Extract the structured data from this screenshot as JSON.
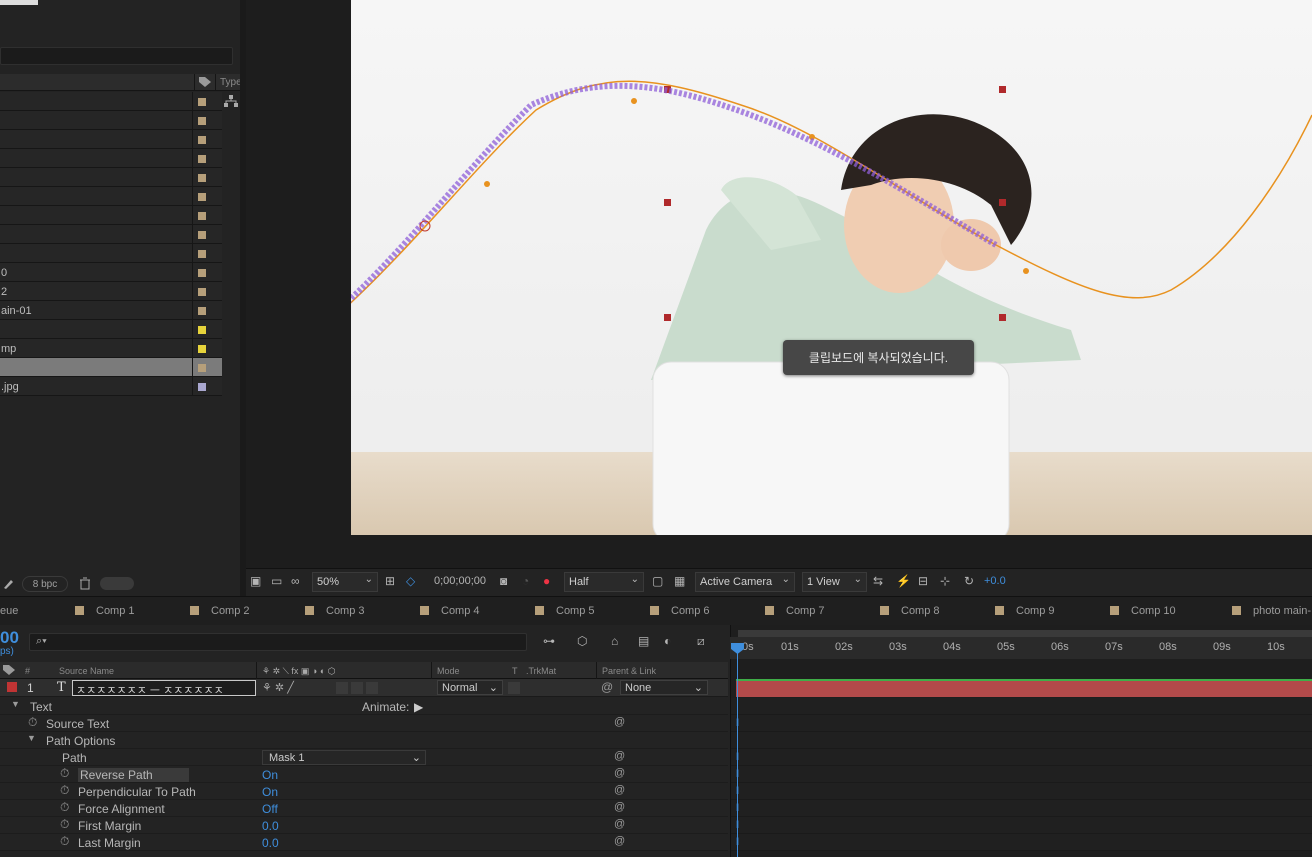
{
  "project": {
    "type_header": "Type",
    "items": [
      {
        "name": "",
        "color": "#b69f7a"
      },
      {
        "name": "",
        "color": "#b69f7a"
      },
      {
        "name": "",
        "color": "#b69f7a"
      },
      {
        "name": "",
        "color": "#b69f7a"
      },
      {
        "name": "",
        "color": "#b69f7a"
      },
      {
        "name": "",
        "color": "#b69f7a"
      },
      {
        "name": "",
        "color": "#b69f7a"
      },
      {
        "name": "",
        "color": "#b69f7a"
      },
      {
        "name": "",
        "color": "#b69f7a"
      },
      {
        "name": "0",
        "color": "#b69f7a"
      },
      {
        "name": "2",
        "color": "#b69f7a"
      },
      {
        "name": "ain-01",
        "color": "#b69f7a"
      },
      {
        "name": "",
        "color": "#e6d33b"
      },
      {
        "name": "mp",
        "color": "#e6d33b"
      },
      {
        "name": "",
        "color": "#b69f7a",
        "selected": true
      },
      {
        "name": ".jpg",
        "color": "#a9a7cf"
      }
    ],
    "bit_depth": "8 bpc"
  },
  "viewer": {
    "tooltip": "클립보드에 복사되었습니다.",
    "zoom": "50%",
    "timecode": "0;00;00;00",
    "resolution": "Half",
    "camera": "Active Camera",
    "views": "1 View",
    "exposure": "+0.0"
  },
  "tabs": [
    "eue",
    "Comp 1",
    "Comp 2",
    "Comp 3",
    "Comp 4",
    "Comp 5",
    "Comp 6",
    "Comp 7",
    "Comp 8",
    "Comp 9",
    "Comp 10",
    "photo main-"
  ],
  "timeline": {
    "timecode_partial": "00",
    "fps_partial": "ps)",
    "search_placeholder": "⌕▾",
    "columns": {
      "num": "#",
      "source": "Source Name",
      "mode": "Mode",
      "t": "T",
      "trkmat": ".TrkMat",
      "parent": "Parent & Link"
    },
    "layer": {
      "num": "1",
      "type": "T",
      "name": "ㅈㅈㅈㅈㅈㅈㅈ ㅡ ㅈㅈㅈㅈㅈㅈ",
      "mode": "Normal",
      "parent": "None"
    },
    "props": [
      {
        "label": "Text",
        "value": ""
      },
      {
        "label": "Source Text",
        "value": ""
      },
      {
        "label": "Path Options",
        "value": ""
      },
      {
        "label": "Path",
        "value": "Mask 1"
      },
      {
        "label": "Reverse Path",
        "value": "On"
      },
      {
        "label": "Perpendicular To Path",
        "value": "On"
      },
      {
        "label": "Force Alignment",
        "value": "Off"
      },
      {
        "label": "First Margin",
        "value": "0.0"
      },
      {
        "label": "Last Margin",
        "value": "0.0"
      }
    ],
    "animate_label": "Animate:",
    "ruler": [
      "0s",
      "01s",
      "02s",
      "03s",
      "04s",
      "05s",
      "06s",
      "07s",
      "08s",
      "09s",
      "10s"
    ]
  }
}
